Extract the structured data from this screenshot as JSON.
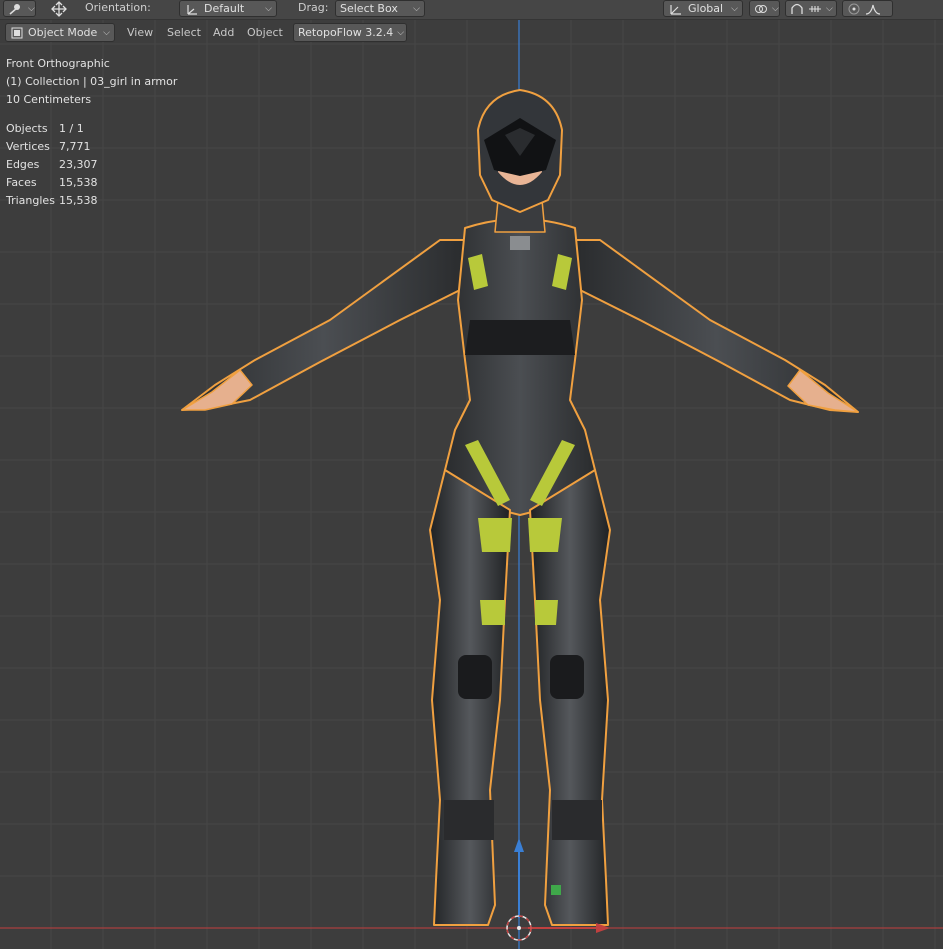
{
  "tool_header": {
    "orientation_label": "Orientation:",
    "orientation_value": "Default",
    "drag_label": "Drag:",
    "drag_value": "Select Box",
    "transform_space": "Global",
    "icons": [
      "cursor-tool-icon",
      "move-tool-icon",
      "orientation-gizmo-icon",
      "transform-space-icon",
      "pivot-icon",
      "snap-icon",
      "snap-target-icon",
      "proportional-editing-icon",
      "falloff-icon"
    ]
  },
  "mode_header": {
    "mode": "Object Mode",
    "menus": [
      "View",
      "Select",
      "Add",
      "Object"
    ],
    "addon": "RetopoFlow 3.2.4"
  },
  "overlay": {
    "view_name": "Front Orthographic",
    "collection": "(1) Collection | 03_girl in armor",
    "scale": "10 Centimeters",
    "stats": [
      {
        "label": "Objects",
        "value": "1 / 1"
      },
      {
        "label": "Vertices",
        "value": "7,771"
      },
      {
        "label": "Edges",
        "value": "23,307"
      },
      {
        "label": "Faces",
        "value": "15,538"
      },
      {
        "label": "Triangles",
        "value": "15,538"
      }
    ]
  },
  "colors": {
    "viewport_bg": "#3d3d3d",
    "selection_outline": "#f0a040",
    "z_axis": "#3a7fd5",
    "x_axis": "#c0403f",
    "armor_accent": "#b8c93a"
  }
}
